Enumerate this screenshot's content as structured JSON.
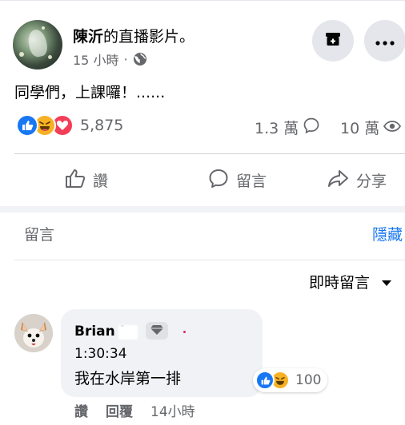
{
  "post": {
    "author": "陳沂",
    "action": "的直播影片。",
    "time": "15 小時",
    "separator": "·",
    "text": "同學們，上課囉！......"
  },
  "stats": {
    "reaction_count": "5,875",
    "comment_count": "1.3 萬",
    "view_count": "10 萬"
  },
  "actions": {
    "like": "讚",
    "comment": "留言",
    "share": "分享"
  },
  "comments_section": {
    "title": "留言",
    "hide": "隱藏",
    "sort": "即時留言"
  },
  "comment": {
    "author": "Brian L",
    "time_text": "1:30:34",
    "text": "我在水岸第一排",
    "reaction_count": "100",
    "like": "讚",
    "reply": "回覆",
    "posted": "14小時"
  },
  "colors": {
    "accent": "#1877f2",
    "secondary_text": "#65676b",
    "like": "#1877f2",
    "haha": "#f7b125",
    "love": "#f33e58",
    "bubble": "#f0f2f5"
  }
}
